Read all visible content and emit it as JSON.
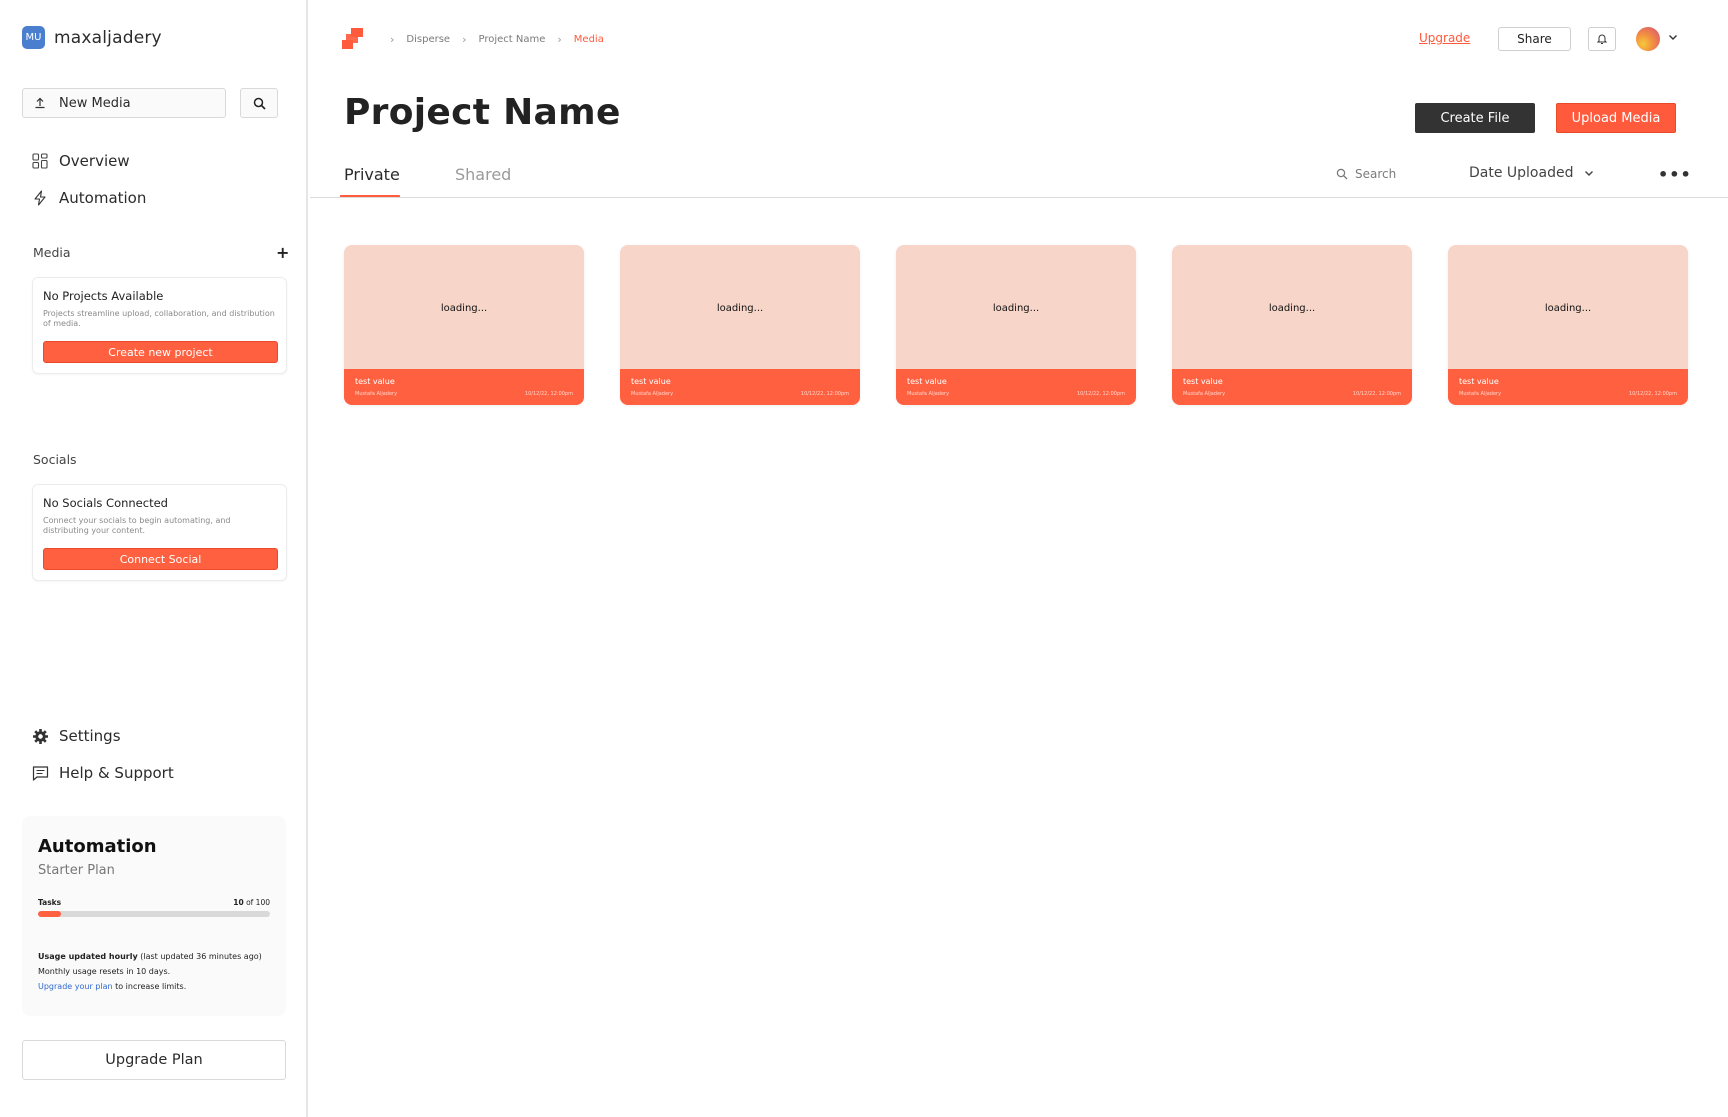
{
  "sidebar": {
    "user_initials": "MU",
    "username": "maxaljadery",
    "new_media_label": "New Media",
    "nav": [
      {
        "label": "Overview",
        "icon": "grid-icon"
      },
      {
        "label": "Automation",
        "icon": "lightning-icon"
      }
    ],
    "media": {
      "label": "Media",
      "empty_title": "No Projects Available",
      "empty_desc": "Projects streamline upload, collaboration, and distribution of media.",
      "button": "Create new project"
    },
    "socials": {
      "label": "Socials",
      "empty_title": "No Socials Connected",
      "empty_desc": "Connect your socials to begin automating, and distributing your content.",
      "button": "Connect Social"
    },
    "bottom_nav": [
      {
        "label": "Settings",
        "icon": "gear-icon"
      },
      {
        "label": "Help & Support",
        "icon": "chat-icon"
      }
    ],
    "usage": {
      "title": "Automation",
      "plan": "Starter Plan",
      "tasks_label": "Tasks",
      "tasks_used": "10",
      "tasks_of": "of 100",
      "progress_fraction": 0.1,
      "note_bold": "Usage updated hourly",
      "note_rest": " (last updated 36 minutes ago)",
      "note_line2": "Monthly usage resets in 10 days.",
      "note_link": "Upgrade your plan",
      "note_link_rest": " to increase limits."
    },
    "upgrade_plan": "Upgrade Plan"
  },
  "header": {
    "breadcrumb": [
      "Disperse",
      "Project Name",
      "Media"
    ],
    "upgrade": "Upgrade",
    "share": "Share"
  },
  "main": {
    "title": "Project Name",
    "create_file": "Create File",
    "upload_media": "Upload Media",
    "tabs": [
      {
        "label": "Private",
        "active": true
      },
      {
        "label": "Shared",
        "active": false
      }
    ],
    "search_label": "Search",
    "sort_label": "Date Uploaded",
    "cards": [
      {
        "loading": "loading...",
        "name": "test value",
        "author": "Mustafa Aljadery",
        "date": "10/12/22, 12:00pm"
      },
      {
        "loading": "loading...",
        "name": "test value",
        "author": "Mustafa Aljadery",
        "date": "10/12/22, 12:00pm"
      },
      {
        "loading": "loading...",
        "name": "test value",
        "author": "Mustafa Aljadery",
        "date": "10/12/22, 12:00pm"
      },
      {
        "loading": "loading...",
        "name": "test value",
        "author": "Mustafa Aljadery",
        "date": "10/12/22, 12:00pm"
      },
      {
        "loading": "loading...",
        "name": "test value",
        "author": "Mustafa Aljadery",
        "date": "10/12/22, 12:00pm"
      }
    ]
  },
  "colors": {
    "accent": "#ff5a3c",
    "card_bg": "#f7d5c8",
    "dark_button": "#333333",
    "avatar_badge": "#4a7fd0"
  }
}
